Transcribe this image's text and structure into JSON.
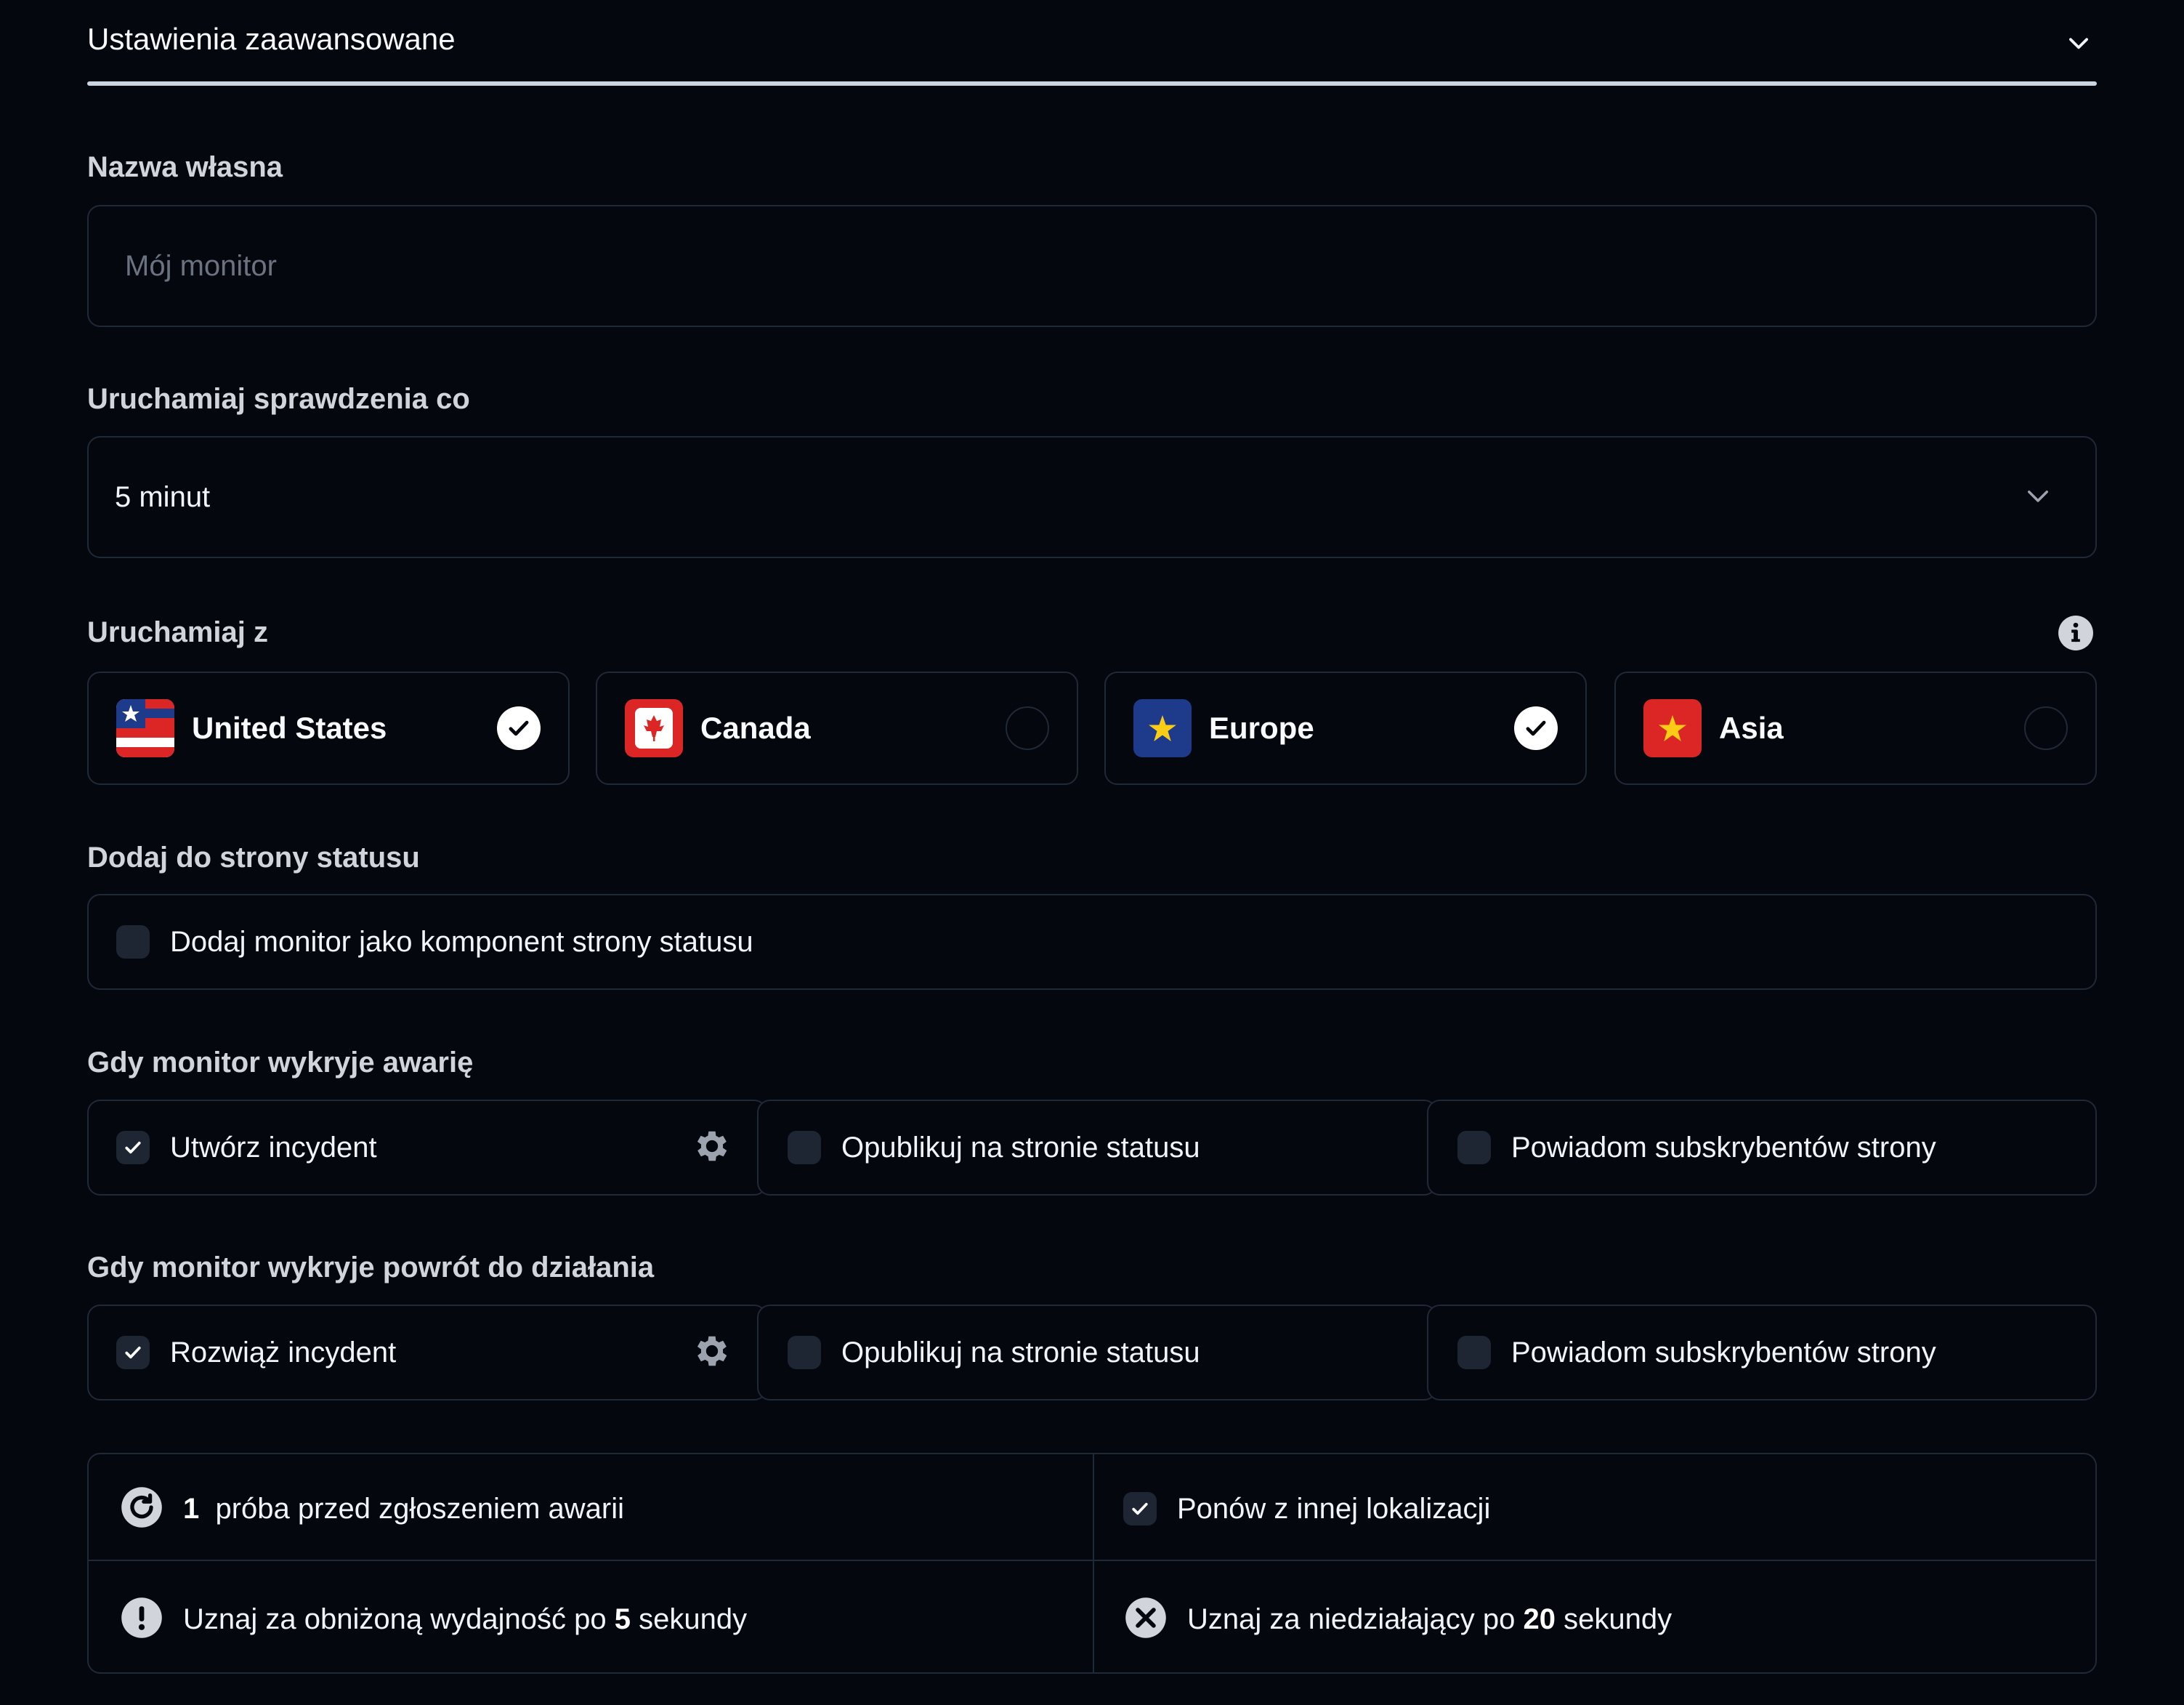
{
  "header": {
    "title": "Ustawienia zaawansowane"
  },
  "name_field": {
    "label": "Nazwa własna",
    "placeholder": "Mój monitor"
  },
  "interval_field": {
    "label": "Uruchamiaj sprawdzenia co",
    "value": "5 minut"
  },
  "regions": {
    "label": "Uruchamiaj z",
    "items": [
      {
        "name": "United States",
        "selected": true,
        "flag": "us-flag"
      },
      {
        "name": "Canada",
        "selected": false,
        "flag": "canada-flag"
      },
      {
        "name": "Europe",
        "selected": true,
        "flag": "eu-flag"
      },
      {
        "name": "Asia",
        "selected": false,
        "flag": "asia-flag"
      }
    ]
  },
  "status_page": {
    "label": "Dodaj do strony statusu",
    "option": "Dodaj monitor jako komponent strony statusu",
    "checked": false
  },
  "on_failure": {
    "label": "Gdy monitor wykryje awarię",
    "options": [
      {
        "label": "Utwórz incydent",
        "checked": true
      },
      {
        "label": "Opublikuj na stronie statusu",
        "checked": false
      },
      {
        "label": "Powiadom subskrybentów strony",
        "checked": false
      }
    ]
  },
  "on_recovery": {
    "label": "Gdy monitor wykryje powrót do działania",
    "options": [
      {
        "label": "Rozwiąż incydent",
        "checked": true
      },
      {
        "label": "Opublikuj na stronie statusu",
        "checked": false
      },
      {
        "label": "Powiadom subskrybentów strony",
        "checked": false
      }
    ]
  },
  "thresholds": {
    "retries_count": "1",
    "retries_text": "próba przed zgłoszeniem awarii",
    "retry_other_location": "Ponów z innej lokalizacji",
    "degraded_prefix": "Uznaj za obniżoną wydajność po",
    "degraded_value": "5",
    "degraded_suffix": "sekundy",
    "down_prefix": "Uznaj za niedziałający po",
    "down_value": "20",
    "down_suffix": "sekundy"
  },
  "colors": {
    "background": "#05070e",
    "border": "#1f2937",
    "checkbox": "#1e2533"
  }
}
